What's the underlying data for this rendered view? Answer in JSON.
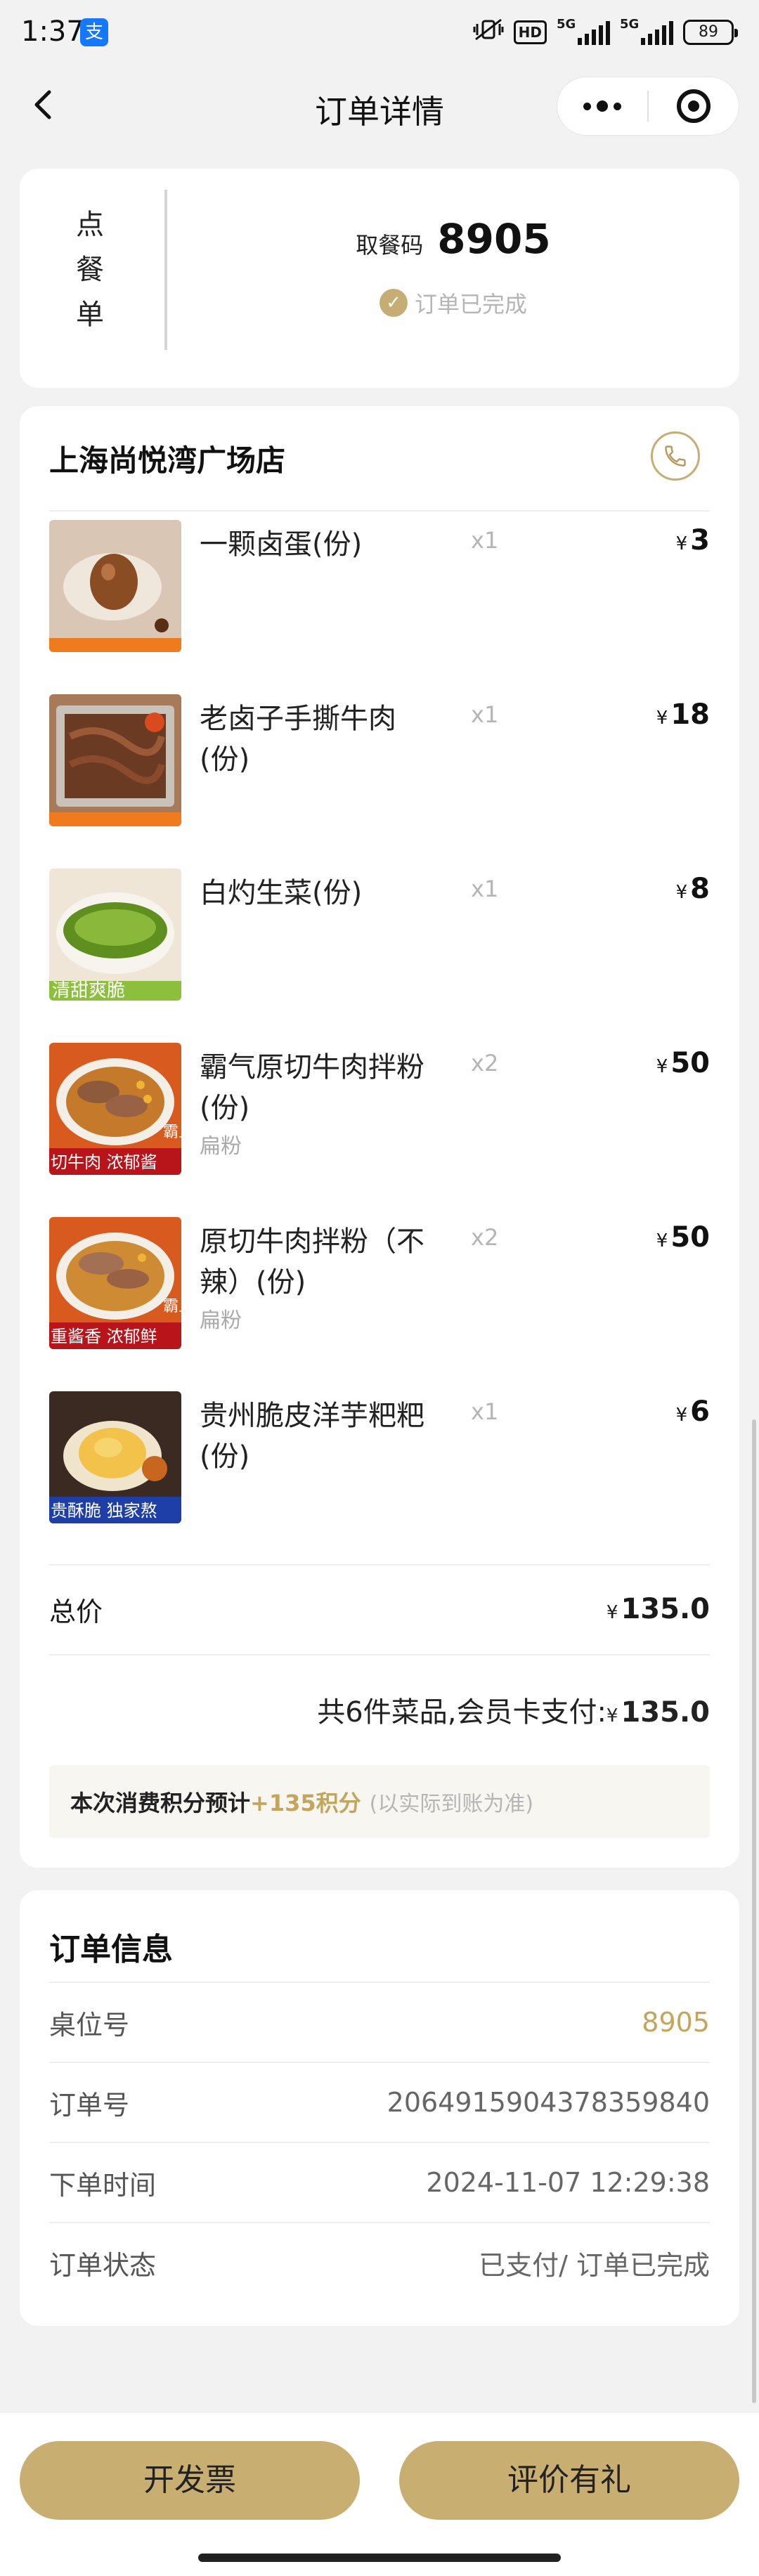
{
  "status_bar": {
    "time": "1:37",
    "alipay_badge": "支",
    "network_1": "5G",
    "network_2": "5G",
    "hd_label": "HD",
    "battery": "89"
  },
  "nav": {
    "title": "订单详情"
  },
  "pickup": {
    "label_chars": [
      "点",
      "餐",
      "单"
    ],
    "code_label": "取餐码",
    "code": "8905",
    "status": "订单已完成"
  },
  "store": {
    "name": "上海尚悦湾广场店"
  },
  "items": [
    {
      "name": "一颗卤蛋(份)",
      "sub": "",
      "qty": "x1",
      "currency": "¥",
      "price": "3"
    },
    {
      "name": "老卤子手撕牛肉(份)",
      "sub": "",
      "qty": "x1",
      "currency": "¥",
      "price": "18"
    },
    {
      "name": "白灼生菜(份)",
      "sub": "",
      "qty": "x1",
      "currency": "¥",
      "price": "8"
    },
    {
      "name": "霸气原切牛肉拌粉(份)",
      "sub": "扁粉",
      "qty": "x2",
      "currency": "¥",
      "price": "50"
    },
    {
      "name": "原切牛肉拌粉（不辣）(份)",
      "sub": "扁粉",
      "qty": "x2",
      "currency": "¥",
      "price": "50"
    },
    {
      "name": "贵州脆皮洋芋粑粑(份)",
      "sub": "",
      "qty": "x1",
      "currency": "¥",
      "price": "6"
    }
  ],
  "thumb_texts": {
    "t3": "清甜爽脆",
    "t4a": "切牛肉 浓郁酱",
    "t4b": "霸上",
    "t5a": "重酱香 浓郁鲜",
    "t5b": "霸上",
    "t6": "贵酥脆 独家熬"
  },
  "totals": {
    "total_label": "总价",
    "currency": "¥",
    "total": "135.0",
    "summary_prefix": "共6件菜品,会员卡支付:",
    "summary_amount": "135.0"
  },
  "points": {
    "prefix": "本次消费积分预计",
    "amount": "+135积分",
    "note": "(以实际到账为准)"
  },
  "order_info": {
    "title": "订单信息",
    "rows": [
      {
        "key": "桌位号",
        "value": "8905"
      },
      {
        "key": "订单号",
        "value": "2064915904378359840"
      },
      {
        "key": "下单时间",
        "value": "2024-11-07 12:29:38"
      },
      {
        "key": "订单状态",
        "value": "已支付/ 订单已完成"
      }
    ]
  },
  "buttons": {
    "invoice": "开发票",
    "review": "评价有礼"
  },
  "colors": {
    "gold": "#c9ae72",
    "gold_text": "#c3a55c",
    "background": "#f2f2f2"
  }
}
